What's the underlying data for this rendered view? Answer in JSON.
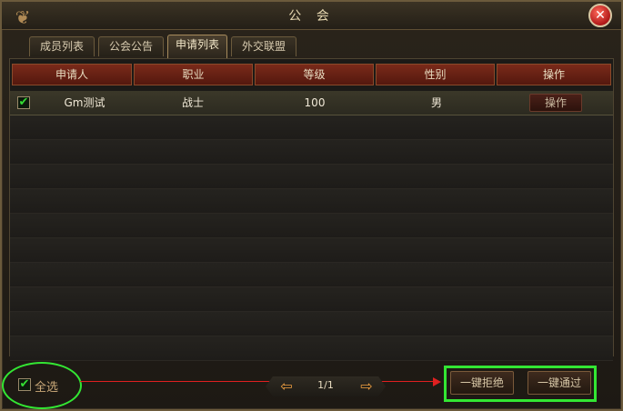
{
  "window": {
    "title": "公 会",
    "close_glyph": "✕"
  },
  "tabs": [
    {
      "label": "成员列表",
      "active": false
    },
    {
      "label": "公会公告",
      "active": false
    },
    {
      "label": "申请列表",
      "active": true
    },
    {
      "label": "外交联盟",
      "active": false
    }
  ],
  "table": {
    "columns": [
      "申请人",
      "职业",
      "等级",
      "性别",
      "操作"
    ],
    "rows": [
      {
        "checked": true,
        "applicant": "Gm测试",
        "class": "战士",
        "level": "100",
        "gender": "男",
        "action": "操作"
      }
    ]
  },
  "footer": {
    "select_all_label": "全选",
    "select_all_checked": true,
    "page": "1/1",
    "reject_all_label": "一键拒绝",
    "approve_all_label": "一键通过"
  },
  "icons": {
    "prev": "arrow-left-icon",
    "next": "arrow-right-icon",
    "check": "checkmark-icon",
    "close": "close-icon"
  },
  "colors": {
    "header_red": "#7a2a1a",
    "annotation_green": "#33e633",
    "annotation_red": "#e02020"
  }
}
